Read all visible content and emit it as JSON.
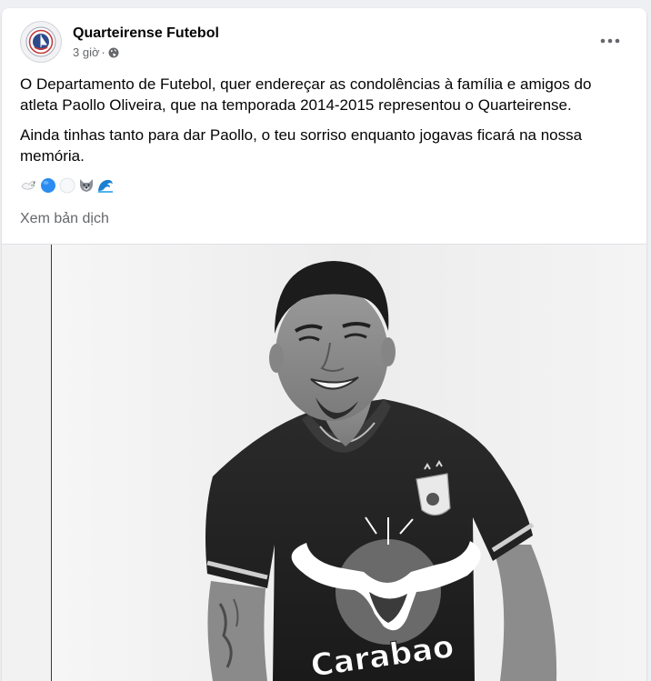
{
  "post": {
    "page_name": "Quarteirense Futebol",
    "time": "3 giờ",
    "separator": "·",
    "privacy_icon": "globe-icon",
    "more_icon": "ellipsis-icon",
    "paragraphs": [
      "O Departamento de Futebol, quer endereçar as condolências à família e amigos do atleta Paollo Oliveira, que na temporada 2014-2015 representou o Quarteirense.",
      "Ainda tinhas tanto para dar Paollo, o teu sorriso enquanto jogavas ficará na nossa memória."
    ],
    "emojis": [
      "dove-emoji",
      "blue-circle-emoji",
      "white-circle-emoji",
      "wolf-emoji",
      "water-wave-emoji"
    ],
    "translate_label": "Xem bản dịch"
  },
  "photo": {
    "sponsor_text": "Carabao",
    "style": "black-and-white"
  },
  "colors": {
    "text": "#050505",
    "secondary_text": "#65676b",
    "card_bg": "#ffffff",
    "page_bg": "#eef0f3"
  }
}
